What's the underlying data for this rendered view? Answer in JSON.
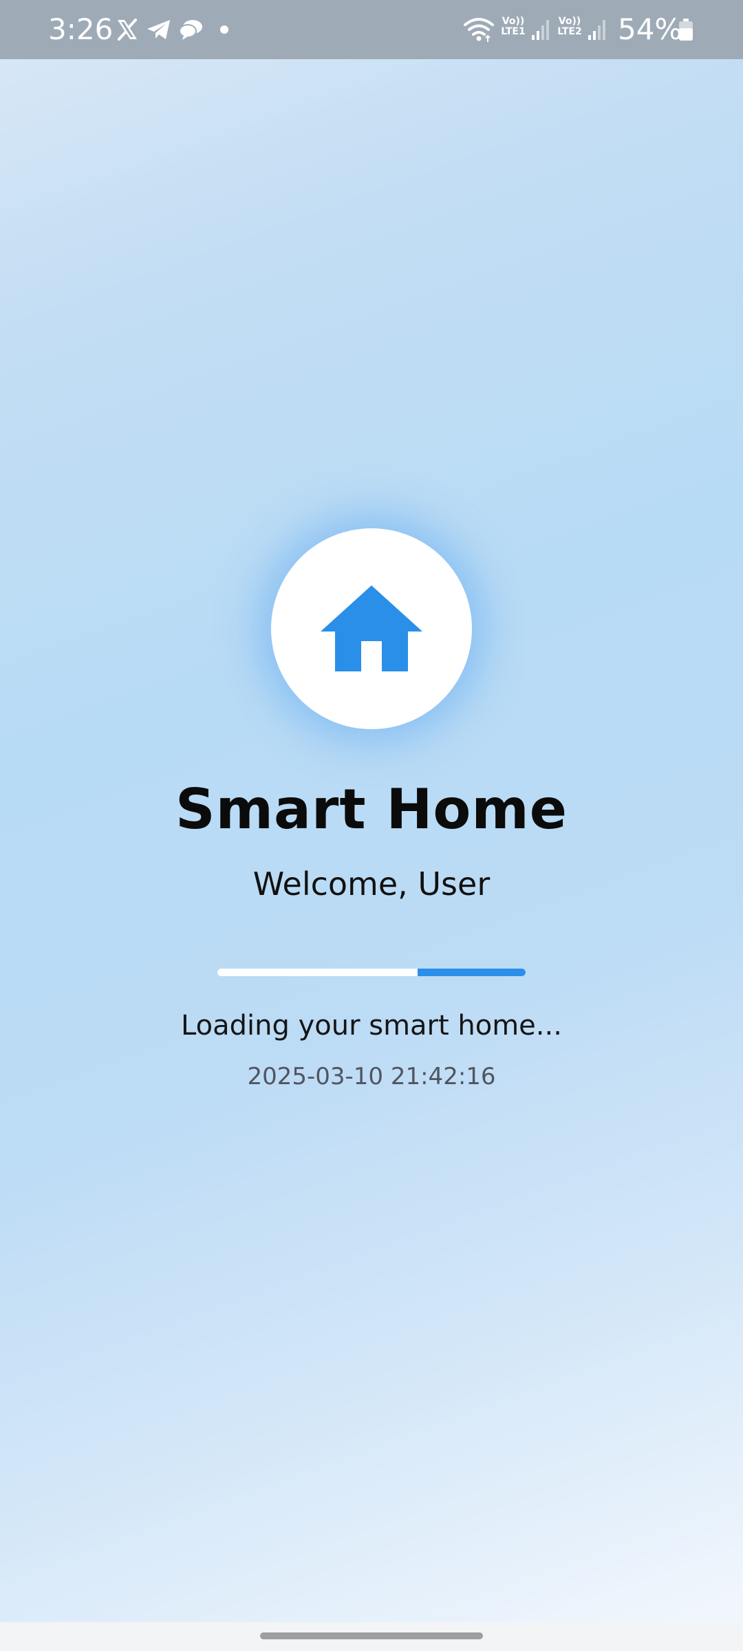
{
  "status_bar": {
    "time": "3:26",
    "battery_percent": "54%",
    "sim1_label_top": "Vo))",
    "sim1_label_bottom": "LTE1",
    "sim2_label_top": "Vo))",
    "sim2_label_bottom": "LTE2",
    "notification_icons": [
      "x-icon",
      "telegram-icon",
      "chat-bubble-icon",
      "dot-icon"
    ],
    "system_icons": [
      "wifi-icon",
      "signal-icon",
      "signal-icon",
      "battery-icon"
    ]
  },
  "splash": {
    "logo_icon": "home-icon",
    "title": "Smart Home",
    "welcome": "Welcome, User",
    "progress": 0.35,
    "loading_text": "Loading your smart home...",
    "timestamp": "2025-03-10 21:42:16"
  },
  "colors": {
    "accent": "#2a8fe8",
    "status_bar": "#9eabb7",
    "background_mid": "#b8dbf5"
  }
}
